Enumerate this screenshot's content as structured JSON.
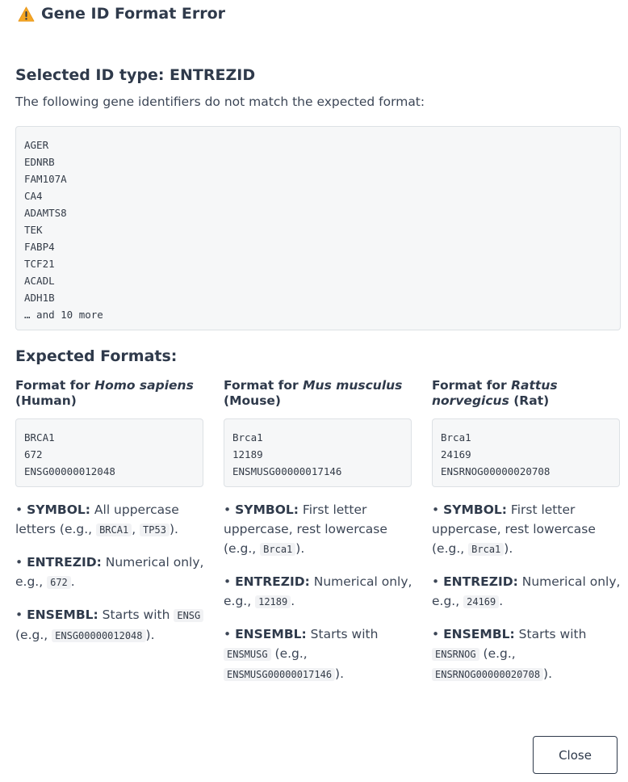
{
  "modal": {
    "title": "Gene ID Format Error",
    "icon": "warning-icon",
    "accent_color": "#f5a623"
  },
  "selected": {
    "heading": "Selected ID type: ENTREZID",
    "intro": "The following gene identifiers do not match the expected format:",
    "ids": [
      "AGER",
      "EDNRB",
      "FAM107A",
      "CA4",
      "ADAMTS8",
      "TEK",
      "FABP4",
      "TCF21",
      "ACADL",
      "ADH1B"
    ],
    "more": "… and 10 more"
  },
  "expected": {
    "heading": "Expected Formats:",
    "columns": [
      {
        "title_prefix": "Format for ",
        "species": "Homo sapiens",
        "title_suffix": "(Human)",
        "examples": [
          "BRCA1",
          "672",
          "ENSG00000012048"
        ],
        "rules": {
          "symbol_label": "SYMBOL:",
          "symbol_text": "All uppercase letters (e.g.,",
          "symbol_codes": [
            "BRCA1",
            "TP53"
          ],
          "entrez_label": "ENTREZID:",
          "entrez_text": "Numerical only, e.g.,",
          "entrez_code": "672",
          "ensembl_label": "ENSEMBL:",
          "ensembl_text": "Starts with",
          "ensembl_prefix": "ENSG",
          "ensembl_eg": "(e.g.,",
          "ensembl_code": "ENSG00000012048"
        }
      },
      {
        "title_prefix": "Format for ",
        "species": "Mus musculus",
        "title_suffix": "(Mouse)",
        "examples": [
          "Brca1",
          "12189",
          "ENSMUSG00000017146"
        ],
        "rules": {
          "symbol_label": "SYMBOL:",
          "symbol_text": "First letter uppercase, rest lowercase (e.g.,",
          "symbol_code": "Brca1",
          "entrez_label": "ENTREZID:",
          "entrez_text": "Numerical only, e.g.,",
          "entrez_code": "12189",
          "ensembl_label": "ENSEMBL:",
          "ensembl_text": "Starts with",
          "ensembl_prefix": "ENSMUSG",
          "ensembl_eg": "(e.g.,",
          "ensembl_code": "ENSMUSG00000017146"
        }
      },
      {
        "title_prefix": "Format for ",
        "species": "Rattus norvegicus",
        "title_suffix": "(Rat)",
        "examples": [
          "Brca1",
          "24169",
          "ENSRNOG00000020708"
        ],
        "rules": {
          "symbol_label": "SYMBOL:",
          "symbol_text": "First letter uppercase, rest lowercase (e.g.,",
          "symbol_code": "Brca1",
          "entrez_label": "ENTREZID:",
          "entrez_text": "Numerical only, e.g.,",
          "entrez_code": "24169",
          "ensembl_label": "ENSEMBL:",
          "ensembl_text": "Starts with",
          "ensembl_prefix": "ENSRNOG",
          "ensembl_eg": "(e.g.,",
          "ensembl_code": "ENSRNOG00000020708"
        }
      }
    ]
  },
  "footer": {
    "close_label": "Close"
  }
}
